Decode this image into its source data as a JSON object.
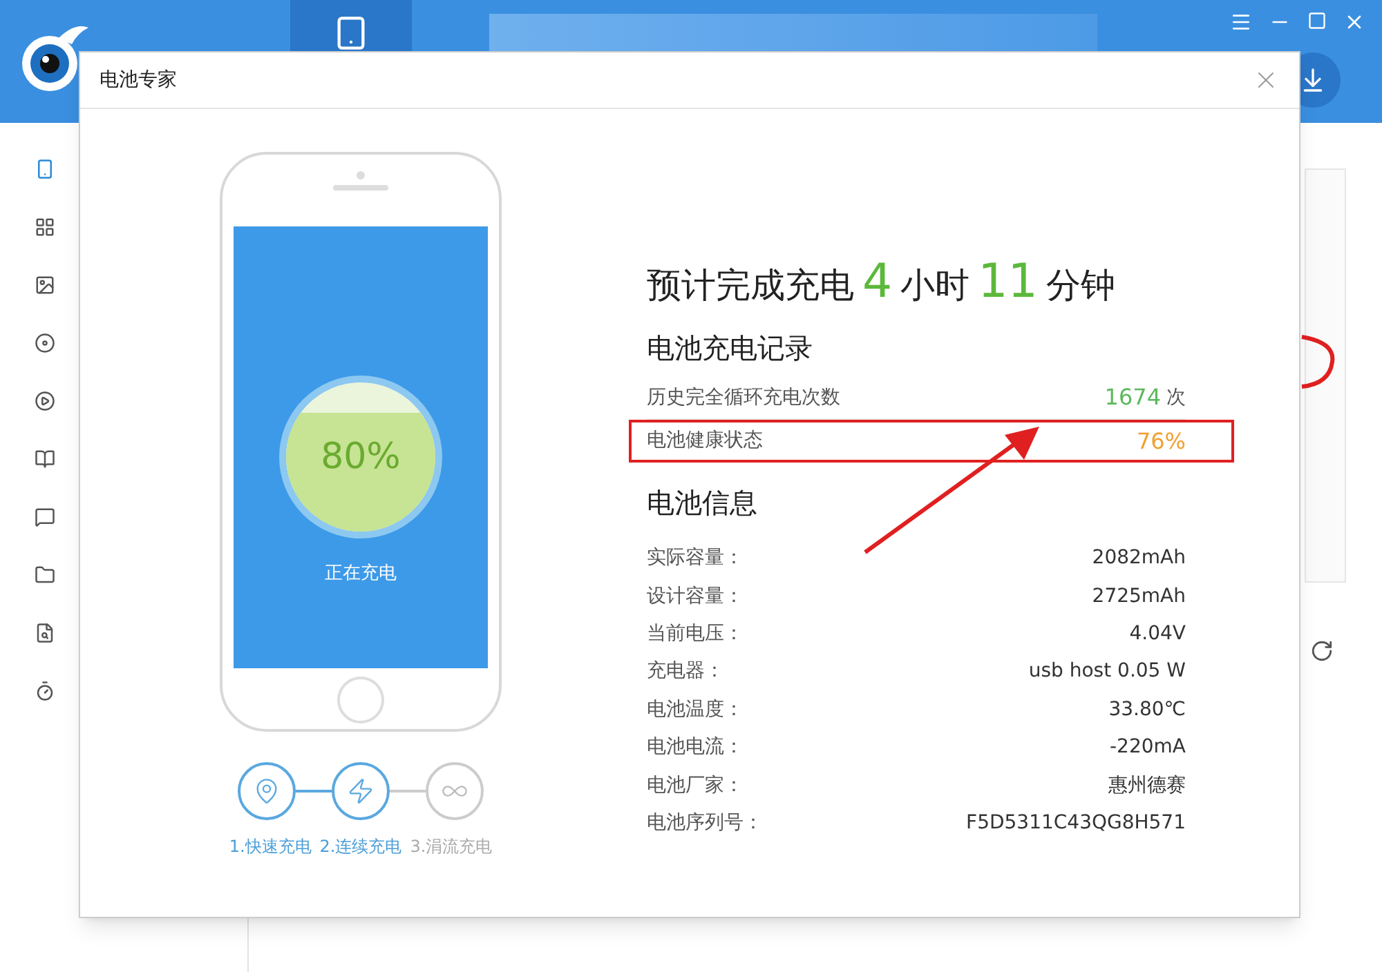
{
  "app": {
    "sidebar": {
      "items": [
        {
          "selected": true
        },
        {
          "selected": false
        },
        {
          "selected": false
        },
        {
          "selected": false
        },
        {
          "selected": false
        },
        {
          "selected": false
        },
        {
          "selected": false
        },
        {
          "selected": false
        },
        {
          "selected": false
        },
        {
          "selected": false
        }
      ]
    }
  },
  "dialog": {
    "title": "电池专家",
    "phone": {
      "percent": "80%",
      "status": "正在充电"
    },
    "steps": [
      {
        "label": "1.快速充电",
        "kind": "pin",
        "active": true
      },
      {
        "label": "2.连续充电",
        "kind": "bolt",
        "active": true
      },
      {
        "label": "3.涓流充电",
        "kind": "infinity",
        "active": false
      }
    ],
    "estimate": [
      {
        "text": "预计完成充电",
        "highlight": false
      },
      {
        "text": "4",
        "highlight": true
      },
      {
        "text": "小时",
        "highlight": false
      },
      {
        "text": "11",
        "highlight": true
      },
      {
        "text": "分钟",
        "highlight": false
      }
    ],
    "record": {
      "title": "电池充电记录",
      "rows": [
        {
          "label": "历史完全循环充电次数",
          "value": "1674",
          "unit": "次",
          "color": "#5cb85c",
          "highlighted": false
        },
        {
          "label": "电池健康状态",
          "value": "76%",
          "color": "#f0a030",
          "highlighted": true
        }
      ]
    },
    "info": {
      "title": "电池信息",
      "rows": [
        {
          "label": "实际容量：",
          "value": "2082mAh"
        },
        {
          "label": "设计容量：",
          "value": "2725mAh"
        },
        {
          "label": "当前电压：",
          "value": "4.04V"
        },
        {
          "label": "充电器：",
          "value": "usb host 0.05 W"
        },
        {
          "label": "电池温度：",
          "value": "33.80℃"
        },
        {
          "label": "电池电流：",
          "value": "-220mA"
        },
        {
          "label": "电池厂家：",
          "value": "惠州德赛"
        },
        {
          "label": "电池序列号：",
          "value": "F5D5311C43QG8H571"
        }
      ]
    }
  }
}
